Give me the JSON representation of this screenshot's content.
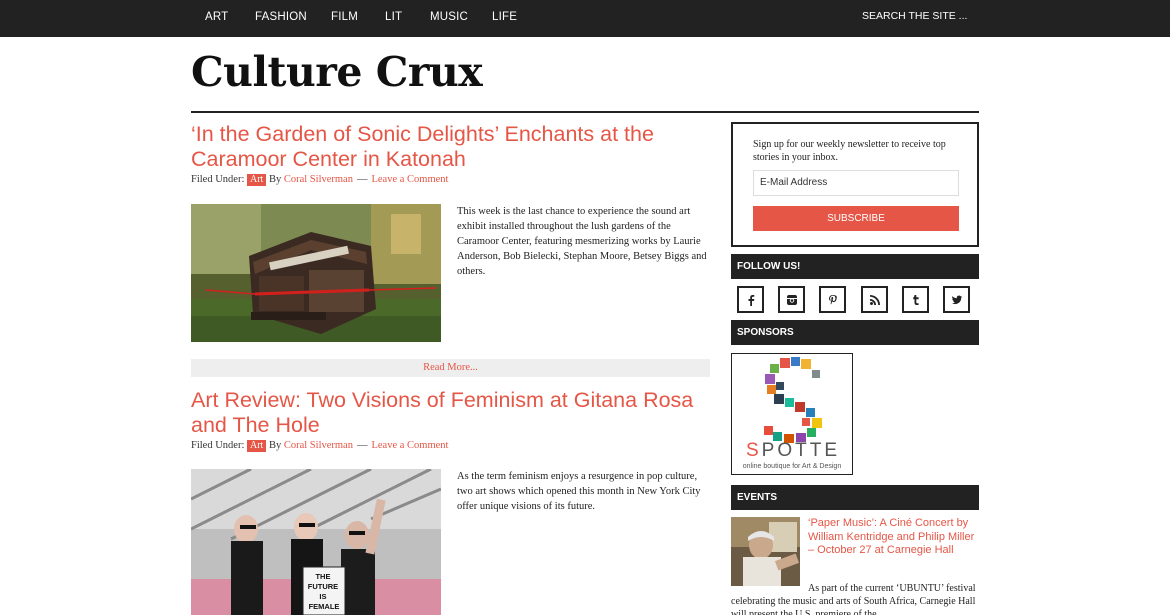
{
  "nav": {
    "items": [
      "ART",
      "FASHION",
      "FILM",
      "LIT",
      "MUSIC",
      "LIFE"
    ],
    "search_placeholder": "SEARCH THE SITE ..."
  },
  "site": {
    "logo": "Culture Crux"
  },
  "posts": [
    {
      "title": "‘In the Garden of Sonic Delights’ Enchants at the Caramoor Center in Katonah",
      "filed_under": "Filed Under:",
      "category": "Art",
      "by": "By",
      "author": "Coral Silverman",
      "dash": "—",
      "comment": "Leave a Comment",
      "excerpt": "This week is the last chance to experience the sound art exhibit installed throughout the lush gardens of the Caramoor Center, featuring mesmerizing works by Laurie Anderson, Bob Bielecki, Stephan Moore, Betsey Biggs and others."
    },
    {
      "title": "Art Review: Two Visions of Feminism at Gitana Rosa and The Hole",
      "filed_under": "Filed Under:",
      "category": "Art",
      "by": "By",
      "author": "Coral Silverman",
      "dash": "—",
      "comment": "Leave a Comment",
      "excerpt": "As the term feminism enjoys a resurgence in pop culture, two art shows which opened this month in New York City offer unique visions of its future.",
      "sign_text": [
        "THE",
        "FUTURE",
        "IS",
        "FEMALE"
      ]
    }
  ],
  "read_more": "Read More...",
  "sidebar": {
    "newsletter": {
      "text": "Sign up for our weekly newsletter to receive top stories in your inbox.",
      "placeholder": "E-Mail Address",
      "button": "SUBSCRIBE"
    },
    "follow_title": "FOLLOW US!",
    "social_icons": [
      "facebook-icon",
      "instagram-icon",
      "pinterest-icon",
      "rss-icon",
      "tumblr-icon",
      "twitter-icon"
    ],
    "sponsors_title": "SPONSORS",
    "sponsor": {
      "word_first": "S",
      "word_rest": "POTTE",
      "tagline": "online boutique for Art & Design"
    },
    "events_title": "EVENTS",
    "event": {
      "title": "‘Paper Music’: A Ciné Concert by William Kentridge and Philip Miller – October 27 at Carnegie Hall",
      "text": "As part of the current ‘UBUNTU’ festival celebrating the music and arts of South Africa, Carnegie Hall will present the U.S. premiere of the"
    }
  },
  "colors": {
    "accent": "#e55646",
    "dark": "#222222",
    "readmore_bg": "#eeeeee"
  }
}
